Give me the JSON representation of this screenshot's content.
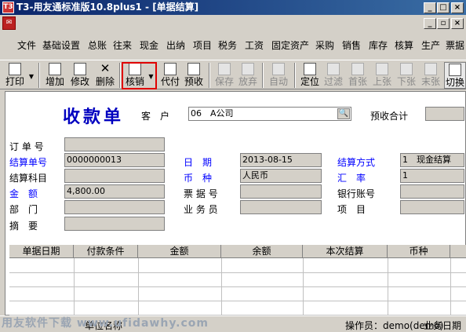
{
  "window": {
    "title": "T3-用友通标准版10.8plus1 - [单据结算]",
    "app_icon": "T3",
    "min": "_",
    "max": "□",
    "close": "×",
    "restore": "▫"
  },
  "menu": [
    "文件",
    "基础设置",
    "总账",
    "往来",
    "现金",
    "出纳",
    "项目",
    "税务",
    "工资",
    "固定资产",
    "采购",
    "销售",
    "库存",
    "核算",
    "生产",
    "票据"
  ],
  "toolbar": {
    "print": "打印",
    "add": "增加",
    "modify": "修改",
    "delete": "删除",
    "writeoff": "核销",
    "proxy": "代付",
    "prepay": "预收",
    "save": "保存",
    "abandon": "放弃",
    "auto": "自动",
    "locate": "定位",
    "filter": "过滤",
    "first": "首张",
    "prev": "上张",
    "next": "下张",
    "last": "末张",
    "switch": "切换"
  },
  "form": {
    "doc_title": "收款单",
    "customer_label": "客　户",
    "customer_value": "06　A公司",
    "prepay_total_label": "预收合计",
    "order_no_label": "订 单 号",
    "settle_no_label": "结算单号",
    "settle_no_value": "0000000013",
    "date_label": "日　期",
    "date_value": "2013-08-15",
    "method_label": "结算方式",
    "method_value": "1　现金结算",
    "account_label": "结算科目",
    "currency_label": "币　种",
    "currency_value": "人民币",
    "rate_label": "汇　率",
    "rate_value": "1",
    "amount_label": "金　额",
    "amount_value": "4,800.00",
    "voucher_label": "票 据 号",
    "bank_label": "银行账号",
    "dept_label": "部　门",
    "staff_label": "业 务 员",
    "project_label": "项　目",
    "memo_label": "摘　要"
  },
  "grid": {
    "columns": [
      "单据日期",
      "付款条件",
      "金额",
      "余额",
      "本次结算",
      "币种"
    ]
  },
  "status": {
    "operator": "操作员：demo(demo)",
    "biz_date": "业务日期",
    "unit": "单位名称"
  },
  "watermark": "用友软件下载 www.ufidawhy.com"
}
